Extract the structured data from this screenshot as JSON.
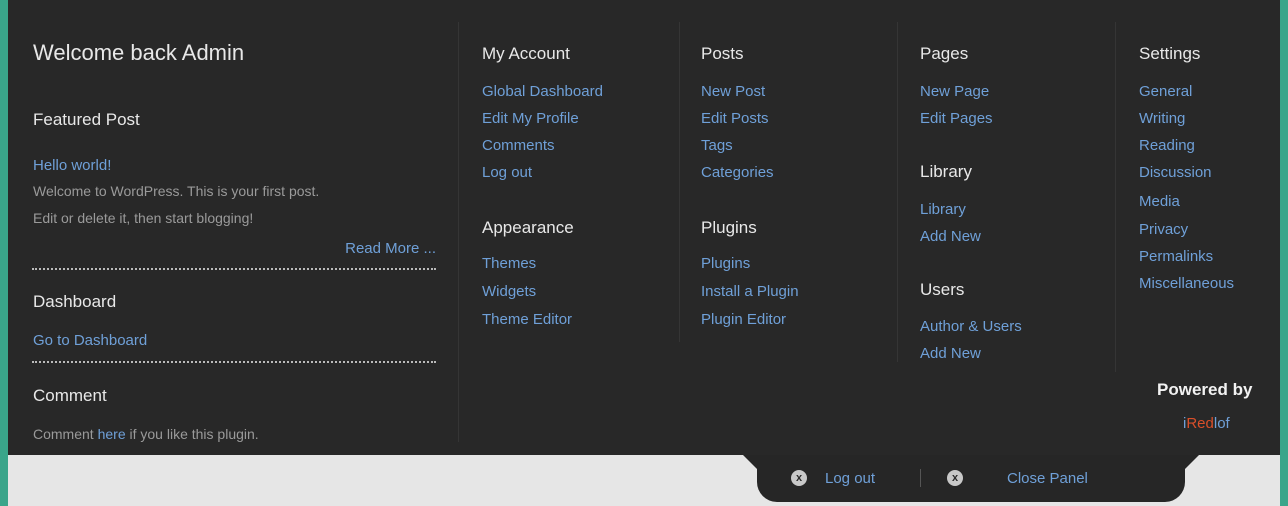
{
  "welcome": "Welcome back Admin",
  "featured": {
    "heading": "Featured Post",
    "post_title": "Hello world!",
    "excerpt_line1": "Welcome to WordPress. This is your first post.",
    "excerpt_line2": "Edit or delete it, then start blogging!",
    "read_more": "Read More ..."
  },
  "dashboard": {
    "heading": "Dashboard",
    "link": "Go to Dashboard"
  },
  "comment": {
    "heading": "Comment",
    "prefix": "Comment ",
    "link": "here",
    "suffix": " if you like this plugin."
  },
  "my_account": {
    "heading": "My Account",
    "items": [
      "Global Dashboard",
      "Edit My Profile",
      "Comments",
      "Log out"
    ]
  },
  "appearance": {
    "heading": "Appearance",
    "items": [
      "Themes",
      "Widgets",
      "Theme Editor"
    ]
  },
  "posts": {
    "heading": "Posts",
    "items": [
      "New Post",
      "Edit Posts",
      "Tags",
      "Categories"
    ]
  },
  "plugins": {
    "heading": "Plugins",
    "items": [
      "Plugins",
      "Install a Plugin",
      "Plugin Editor"
    ]
  },
  "pages": {
    "heading": "Pages",
    "items": [
      "New Page",
      "Edit Pages"
    ]
  },
  "library": {
    "heading": "Library",
    "items": [
      "Library",
      "Add New"
    ]
  },
  "users": {
    "heading": "Users",
    "items": [
      "Author & Users",
      "Add New"
    ]
  },
  "settings": {
    "heading": "Settings",
    "items": [
      "General",
      "Writing",
      "Reading",
      "Discussion",
      "Media",
      "Privacy",
      "Permalinks",
      "Miscellaneous"
    ]
  },
  "powered": {
    "label": "Powered by",
    "brand_i": "i",
    "brand_red": "Red",
    "brand_lof": "lof",
    "brand_red_color": "#d94f2a"
  },
  "tab": {
    "logout": "Log out",
    "close": "Close Panel",
    "close_icon_glyph": "x"
  },
  "colors": {
    "link": "#6fa0d8",
    "panel_bg": "#282828",
    "page_bg": "#3aa58a"
  }
}
